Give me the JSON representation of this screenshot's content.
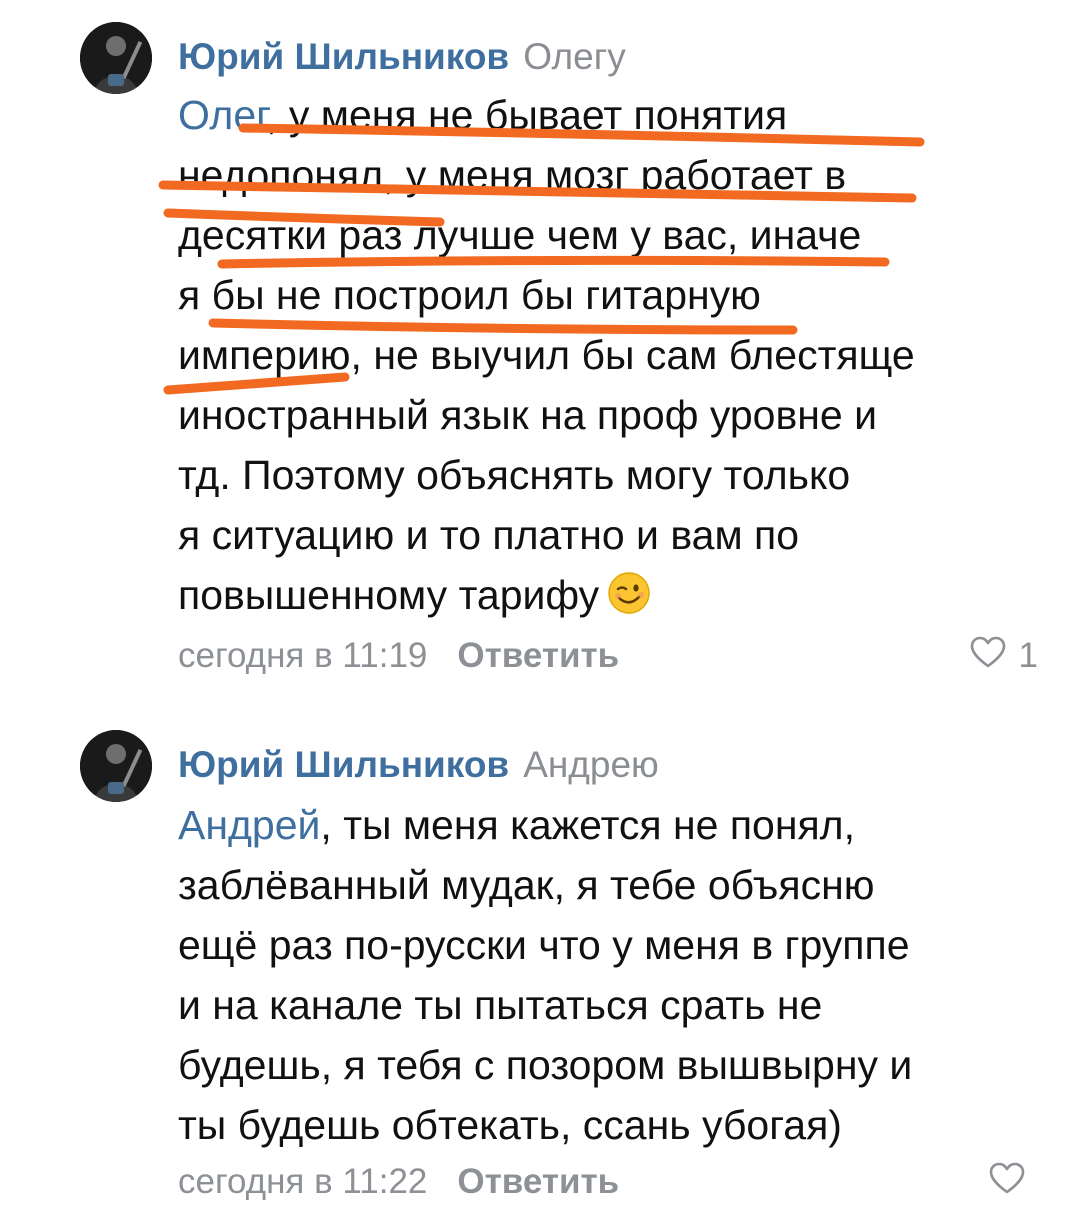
{
  "comments": [
    {
      "author": "Юрий Шильников",
      "reply_to": "Олегу",
      "mention": "Олег",
      "lines": [
        ", у меня не бывает понятия",
        "недопонял, у меня мозг работает в",
        "десятки раз лучше чем у вас, иначе",
        "я бы не построил бы гитарную",
        "империю, не выучил бы сам блестяще",
        "иностранный язык на проф уровне и",
        "тд. Поэтому объяснять могу только",
        "я ситуацию и то платно и вам по",
        "повышенному тарифу"
      ],
      "emoji": "winking-face-icon",
      "time": "сегодня в 11:19",
      "reply_label": "Ответить",
      "likes": "1"
    },
    {
      "author": "Юрий Шильников",
      "reply_to": "Андрею",
      "mention": "Андрей",
      "lines": [
        ", ты меня кажется не понял,",
        "заблёванный мудак, я тебе объясню",
        "ещё раз по-русски что у меня в группе",
        "и на канале ты пытаться срать не",
        "будешь, я тебя с позором вышвырну и",
        "ты будешь обтекать, ссань убогая)"
      ],
      "time": "сегодня в 11:22",
      "reply_label": "Ответить",
      "likes": ""
    }
  ],
  "colors": {
    "link": "#3f6f9f",
    "meta": "#8d9196",
    "highlight": "#f26a21"
  }
}
